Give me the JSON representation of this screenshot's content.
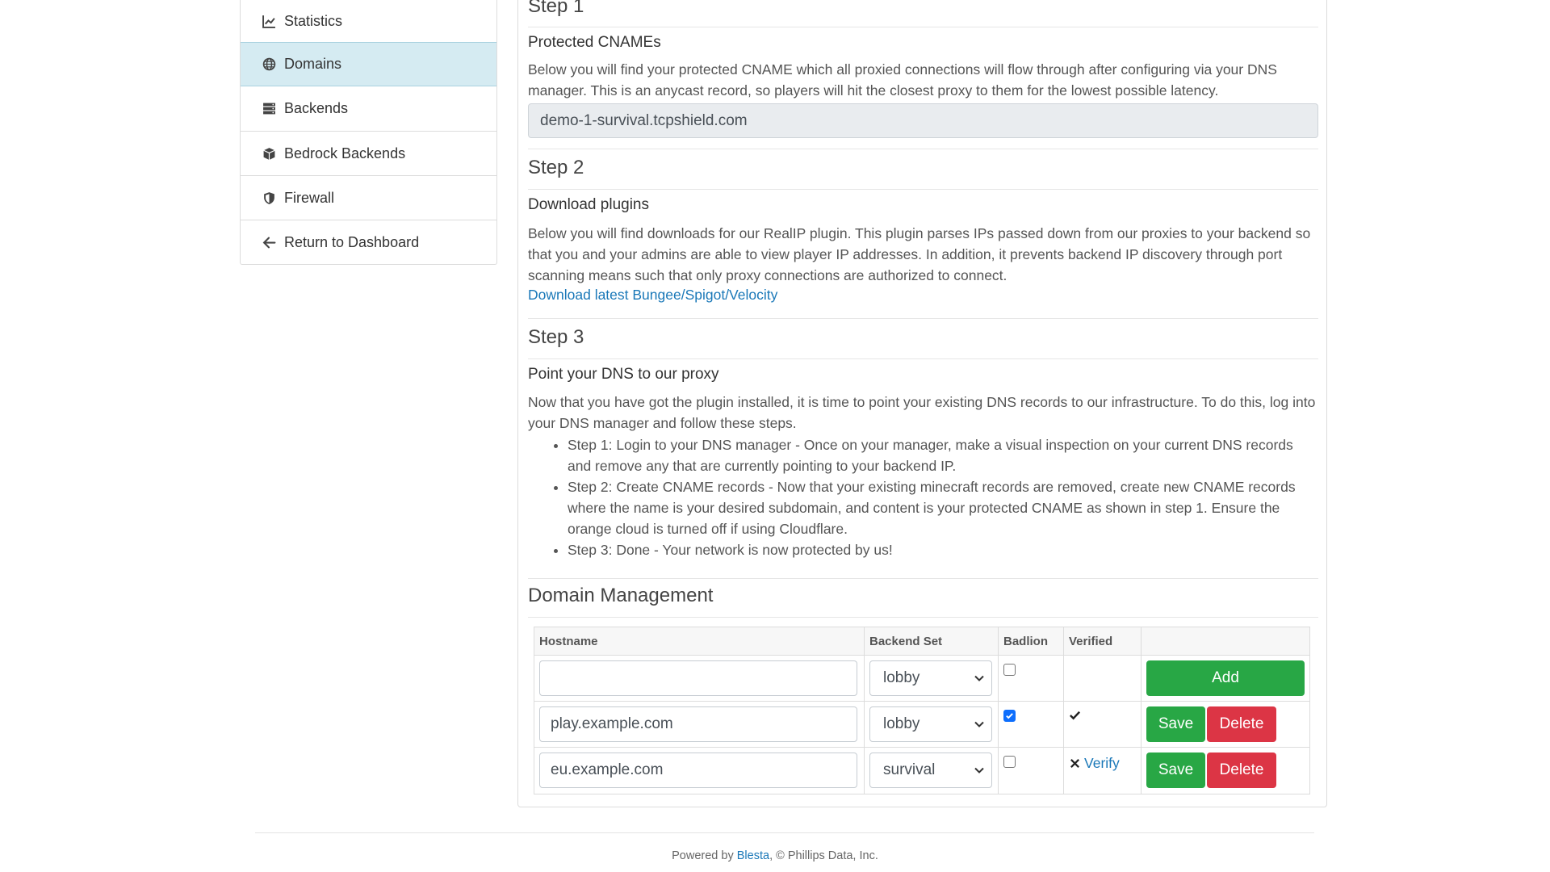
{
  "sidebar": {
    "items": [
      {
        "label": "Statistics",
        "icon": "chart-line-icon",
        "active": false
      },
      {
        "label": "Domains",
        "icon": "globe-icon",
        "active": true
      },
      {
        "label": "Backends",
        "icon": "server-icon",
        "active": false
      },
      {
        "label": "Bedrock Backends",
        "icon": "cube-icon",
        "active": false
      },
      {
        "label": "Firewall",
        "icon": "shield-icon",
        "active": false
      },
      {
        "label": "Return to Dashboard",
        "icon": "arrow-left-icon",
        "active": false
      }
    ]
  },
  "step1": {
    "heading": "Step 1",
    "subheading": "Protected CNAMEs",
    "description": "Below you will find your protected CNAME which all proxied connections will flow through after configuring via your DNS manager. This is an anycast record, so players will hit the closest proxy to them for the lowest possible latency.",
    "cname": "demo-1-survival.tcpshield.com"
  },
  "step2": {
    "heading": "Step 2",
    "subheading": "Download plugins",
    "description": "Below you will find downloads for our RealIP plugin. This plugin parses IPs passed down from our proxies to your backend so that you and your admins are able to view player IP addresses. In addition, it prevents backend IP discovery through port scanning means such that only proxy connections are authorized to connect.",
    "download_link": "Download latest Bungee/Spigot/Velocity"
  },
  "step3": {
    "heading": "Step 3",
    "subheading": "Point your DNS to our proxy",
    "description": "Now that you have got the plugin installed, it is time to point your existing DNS records to our infrastructure. To do this, log into your DNS manager and follow these steps.",
    "items": [
      "Step 1: Login to your DNS manager - Once on your manager, make a visual inspection on your current DNS records and remove any that are currently pointing to your backend IP.",
      "Step 2: Create CNAME records - Now that your existing minecraft records are removed, create new CNAME records where the name is your desired subdomain, and content is your protected CNAME as shown in step 1. Ensure the orange cloud is turned off if using Cloudflare.",
      "Step 3: Done - Your network is now protected by us!"
    ]
  },
  "domain_management": {
    "heading": "Domain Management",
    "columns": [
      "Hostname",
      "Backend Set",
      "Badlion",
      "Verified",
      ""
    ],
    "new_row": {
      "hostname": "",
      "backend_set": "lobby",
      "badlion": false,
      "add_label": "Add"
    },
    "rows": [
      {
        "hostname": "play.example.com",
        "backend_set": "lobby",
        "badlion": true,
        "verified": true,
        "verify_label": "",
        "save_label": "Save",
        "delete_label": "Delete"
      },
      {
        "hostname": "eu.example.com",
        "backend_set": "survival",
        "badlion": false,
        "verified": false,
        "verify_label": "Verify",
        "save_label": "Save",
        "delete_label": "Delete"
      }
    ]
  },
  "footer": {
    "prefix": "Powered by",
    "link": "Blesta",
    "suffix": ", © Phillips Data, Inc."
  },
  "colors": {
    "active_bg": "#d5ebf2",
    "link": "#1a78b8",
    "save": "#28a745",
    "delete": "#dc3545",
    "checkbox": "#0d6efd"
  }
}
